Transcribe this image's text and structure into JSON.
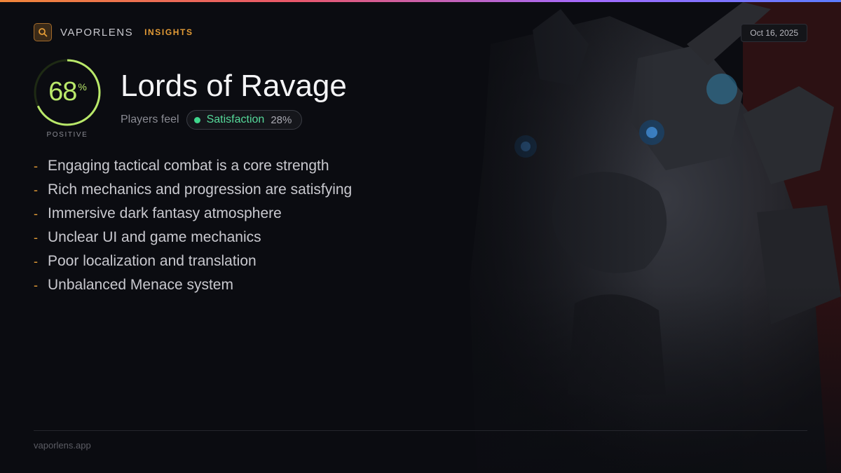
{
  "brand": {
    "name": "VAPORLENS",
    "tag": "INSIGHTS",
    "icon": "search-icon",
    "accent_color": "#e39b36"
  },
  "date": "Oct 16, 2025",
  "score": {
    "value": "68",
    "unit": "%",
    "label": "POSITIVE",
    "fraction": 0.68,
    "color": "#b9e86a"
  },
  "game": {
    "title": "Lords of Ravage"
  },
  "feel": {
    "label": "Players feel",
    "sentiment": "Satisfaction",
    "percent": "28%",
    "color": "#3fd68c"
  },
  "points": [
    "Engaging tactical combat is a core strength",
    "Rich mechanics and progression are satisfying",
    "Immersive dark fantasy atmosphere",
    "Unclear UI and game mechanics",
    "Poor localization and translation",
    "Unbalanced Menace system"
  ],
  "bullet_char": "-",
  "footer": {
    "site": "vaporlens.app"
  }
}
